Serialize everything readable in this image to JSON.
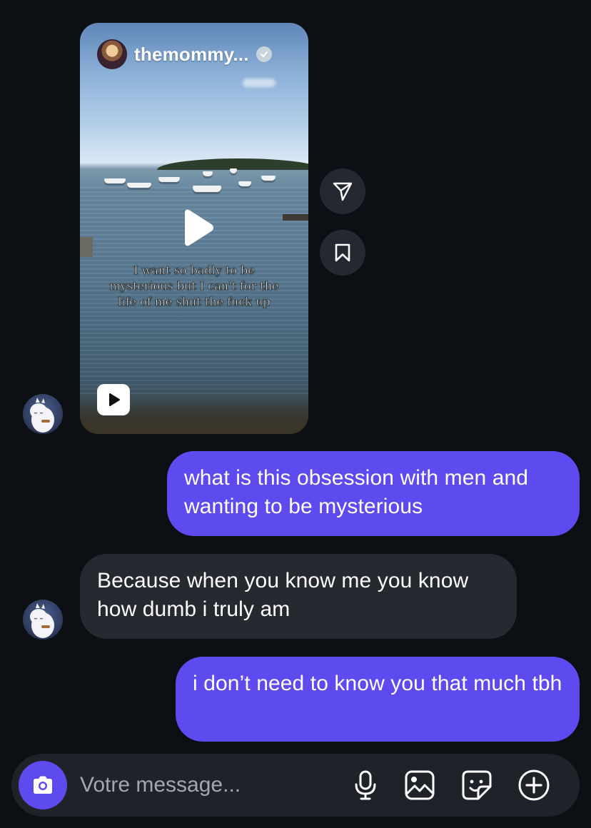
{
  "reel": {
    "username": "themommy...",
    "caption": "I want so badly to be mysterious but I can't for the life of me shut the fuck up",
    "icons": {
      "play": "play-icon",
      "reel_badge": "reels-icon",
      "verified": "verified-badge-icon",
      "share": "send-icon",
      "save": "bookmark-icon"
    }
  },
  "messages": [
    {
      "from": "me",
      "text": "what is this obsession with men and wanting to be mysterious"
    },
    {
      "from": "them",
      "text": "Because when you know me you know how dumb i truly am"
    },
    {
      "from": "me",
      "text": "i don’t need to know you that much tbh"
    }
  ],
  "composer": {
    "placeholder": "Votre message...",
    "icons": [
      "camera-icon",
      "microphone-icon",
      "image-icon",
      "sticker-icon",
      "add-icon"
    ]
  },
  "colors": {
    "background": "#0c0f14",
    "sent_bubble": "#5d4bef",
    "received_bubble": "#262930",
    "composer": "#1f2228",
    "accent": "#5d4bef"
  }
}
